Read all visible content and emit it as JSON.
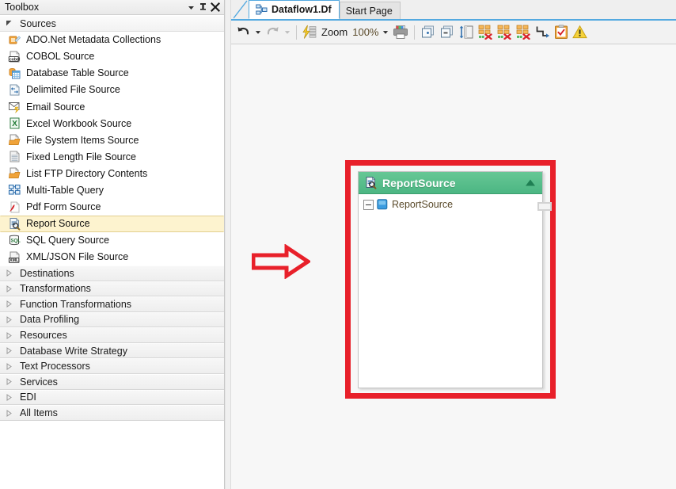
{
  "toolbox": {
    "title": "Toolbox",
    "header_buttons": [
      {
        "name": "toolbox-dropdown-button",
        "icon": "chevron-down-icon"
      },
      {
        "name": "toolbox-pin-button",
        "icon": "pin-icon"
      },
      {
        "name": "toolbox-close-button",
        "icon": "close-icon"
      }
    ],
    "expanded_category": {
      "label": "Sources",
      "expanded": true
    },
    "items": [
      {
        "label": "ADO.Net Metadata Collections",
        "icon": "ado-net-metadata-icon",
        "selected": false
      },
      {
        "label": "COBOL Source",
        "icon": "cobol-source-icon",
        "selected": false
      },
      {
        "label": "Database Table Source",
        "icon": "database-table-icon",
        "selected": false
      },
      {
        "label": "Delimited File Source",
        "icon": "delimited-file-icon",
        "selected": false
      },
      {
        "label": "Email Source",
        "icon": "email-source-icon",
        "selected": false
      },
      {
        "label": "Excel Workbook Source",
        "icon": "excel-workbook-icon",
        "selected": false
      },
      {
        "label": "File System Items Source",
        "icon": "folder-open-icon",
        "selected": false
      },
      {
        "label": "Fixed Length File Source",
        "icon": "fixed-length-file-icon",
        "selected": false
      },
      {
        "label": "List FTP Directory Contents",
        "icon": "folder-open-icon",
        "selected": false
      },
      {
        "label": "Multi-Table Query",
        "icon": "multi-table-query-icon",
        "selected": false
      },
      {
        "label": "Pdf Form Source",
        "icon": "pdf-form-icon",
        "selected": false
      },
      {
        "label": "Report Source",
        "icon": "report-source-icon",
        "selected": true
      },
      {
        "label": "SQL Query Source",
        "icon": "sql-query-icon",
        "selected": false
      },
      {
        "label": "XML/JSON File Source",
        "icon": "xml-json-file-icon",
        "selected": false
      }
    ],
    "collapsed_categories": [
      {
        "label": "Destinations"
      },
      {
        "label": "Transformations"
      },
      {
        "label": "Function Transformations"
      },
      {
        "label": "Data Profiling"
      },
      {
        "label": "Resources"
      },
      {
        "label": "Database Write Strategy"
      },
      {
        "label": "Text Processors"
      },
      {
        "label": "Services"
      },
      {
        "label": "EDI"
      },
      {
        "label": "All Items"
      }
    ]
  },
  "tabs": [
    {
      "label": "Dataflow1.Df",
      "active": true,
      "icon": "dataflow-icon"
    },
    {
      "label": "Start Page",
      "active": false,
      "icon": ""
    }
  ],
  "toolbar": {
    "undo": {
      "name": "undo-button",
      "icon": "undo-arrow-icon"
    },
    "undo_dropdown": {
      "name": "undo-dropdown-button",
      "icon": "chevron-down-icon"
    },
    "redo": {
      "name": "redo-button",
      "icon": "redo-arrow-icon"
    },
    "redo_dropdown": {
      "name": "redo-dropdown-button",
      "icon": "chevron-down-icon"
    },
    "run": {
      "name": "run-dataflow-button",
      "icon": "lightning-bolt-icon"
    },
    "zoom_label": "Zoom",
    "zoom_value": "100%",
    "zoom_dropdown": {
      "name": "zoom-dropdown-button",
      "icon": "chevron-down-icon"
    },
    "print": {
      "name": "print-button",
      "icon": "printer-icon"
    },
    "buttons": [
      {
        "name": "add-copy-button",
        "icon": "add-copy-icon"
      },
      {
        "name": "remove-copy-button",
        "icon": "remove-copy-icon"
      },
      {
        "name": "resize-button",
        "icon": "vertical-resize-icon"
      },
      {
        "name": "remove-links-1-button",
        "icon": "hierarchy-remove-icon"
      },
      {
        "name": "remove-links-2-button",
        "icon": "hierarchy-remove-icon"
      },
      {
        "name": "remove-links-3-button",
        "icon": "hierarchy-remove-icon"
      },
      {
        "name": "auto-route-button",
        "icon": "flow-arrow-icon"
      },
      {
        "name": "validate-button",
        "icon": "clipboard-check-icon"
      },
      {
        "name": "warnings-button",
        "icon": "warning-triangle-icon"
      }
    ]
  },
  "canvas": {
    "node": {
      "title": "ReportSource",
      "header_icon": "report-source-icon",
      "collapse_icon": "triangle-up-icon",
      "tree": [
        {
          "label": "ReportSource",
          "expander": "minus",
          "icon": "blue-square-icon"
        }
      ],
      "port": {
        "name": "output-port"
      }
    },
    "annotations": {
      "highlight_rect": {
        "name": "red-highlight-rectangle",
        "color": "#e8202a"
      },
      "arrow": {
        "name": "red-pointer-arrow",
        "color": "#e8202a",
        "direction": "right"
      }
    }
  },
  "colors": {
    "node_header_green": "#4cb683",
    "annotation_red": "#e8202a",
    "selection_yellow": "#fdf3cf",
    "tab_accent_blue": "#53a9e0"
  }
}
